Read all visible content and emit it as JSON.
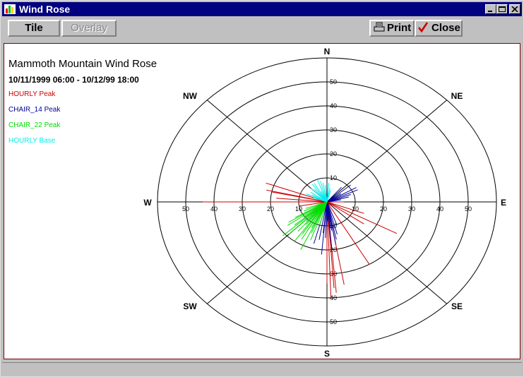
{
  "window": {
    "title": "Wind Rose",
    "icon": "bar-chart-icon",
    "controls": [
      "minimize-icon",
      "maximize-icon",
      "close-icon"
    ]
  },
  "toolbar": {
    "tile_label": "Tile",
    "overlay_label": "Overlay",
    "print_label": "Print",
    "close_label": "Close"
  },
  "chart_data": {
    "type": "scatter",
    "title": "Mammoth Mountain Wind Rose",
    "subtitle": "10/11/1999 06:00 - 10/12/99 18:00",
    "radial_ticks": [
      10,
      20,
      30,
      40,
      50
    ],
    "rlim": [
      0,
      60
    ],
    "directions": [
      "N",
      "NE",
      "E",
      "SE",
      "S",
      "SW",
      "W",
      "NW"
    ],
    "legend_position": "top-left",
    "series": [
      {
        "name": "HOURLY Peak",
        "color": "#cc0000",
        "points": [
          [
            270,
            44
          ],
          [
            270,
            42
          ],
          [
            283,
            22
          ],
          [
            290,
            23
          ],
          [
            282,
            20
          ],
          [
            275,
            18
          ],
          [
            260,
            10
          ],
          [
            118,
            28
          ],
          [
            150,
            30
          ],
          [
            170,
            35
          ],
          [
            175,
            38
          ],
          [
            178,
            40
          ],
          [
            176,
            36
          ],
          [
            180,
            34
          ],
          [
            125,
            16
          ],
          [
            110,
            14
          ],
          [
            90,
            6
          ]
        ]
      },
      {
        "name": "CHAIR_14 Peak",
        "color": "#000099",
        "points": [
          [
            60,
            12
          ],
          [
            50,
            11
          ],
          [
            70,
            9
          ],
          [
            75,
            8
          ],
          [
            40,
            8
          ],
          [
            65,
            12
          ],
          [
            55,
            6
          ],
          [
            80,
            5
          ],
          [
            170,
            18
          ],
          [
            175,
            20
          ],
          [
            185,
            22
          ],
          [
            190,
            16
          ],
          [
            165,
            14
          ],
          [
            172,
            12
          ],
          [
            180,
            10
          ],
          [
            195,
            18
          ],
          [
            160,
            10
          ],
          [
            168,
            16
          ],
          [
            182,
            15
          ],
          [
            178,
            8
          ],
          [
            186,
            13
          ],
          [
            174,
            11
          ]
        ]
      },
      {
        "name": "CHAIR_22 Peak",
        "color": "#00dd00",
        "points": [
          [
            210,
            18
          ],
          [
            215,
            20
          ],
          [
            220,
            16
          ],
          [
            225,
            19
          ],
          [
            230,
            15
          ],
          [
            235,
            17
          ],
          [
            200,
            17
          ],
          [
            205,
            22
          ],
          [
            210,
            14
          ],
          [
            218,
            12
          ],
          [
            240,
            13
          ],
          [
            228,
            21
          ],
          [
            222,
            11
          ],
          [
            213,
            16
          ],
          [
            207,
            12
          ],
          [
            232,
            10
          ],
          [
            245,
            9
          ],
          [
            250,
            8
          ],
          [
            203,
            14
          ],
          [
            225,
            13
          ],
          [
            215,
            9
          ],
          [
            195,
            10
          ],
          [
            238,
            16
          ],
          [
            220,
            8
          ]
        ]
      },
      {
        "name": "HOURLY Base",
        "color": "#00eeee",
        "points": [
          [
            330,
            9
          ],
          [
            340,
            10
          ],
          [
            350,
            8
          ],
          [
            355,
            7
          ],
          [
            300,
            6
          ],
          [
            315,
            8
          ],
          [
            320,
            7
          ],
          [
            345,
            9
          ],
          [
            5,
            8
          ],
          [
            10,
            6
          ],
          [
            290,
            5
          ],
          [
            305,
            7
          ],
          [
            335,
            5
          ],
          [
            325,
            9
          ],
          [
            295,
            8
          ],
          [
            15,
            5
          ]
        ]
      }
    ]
  }
}
